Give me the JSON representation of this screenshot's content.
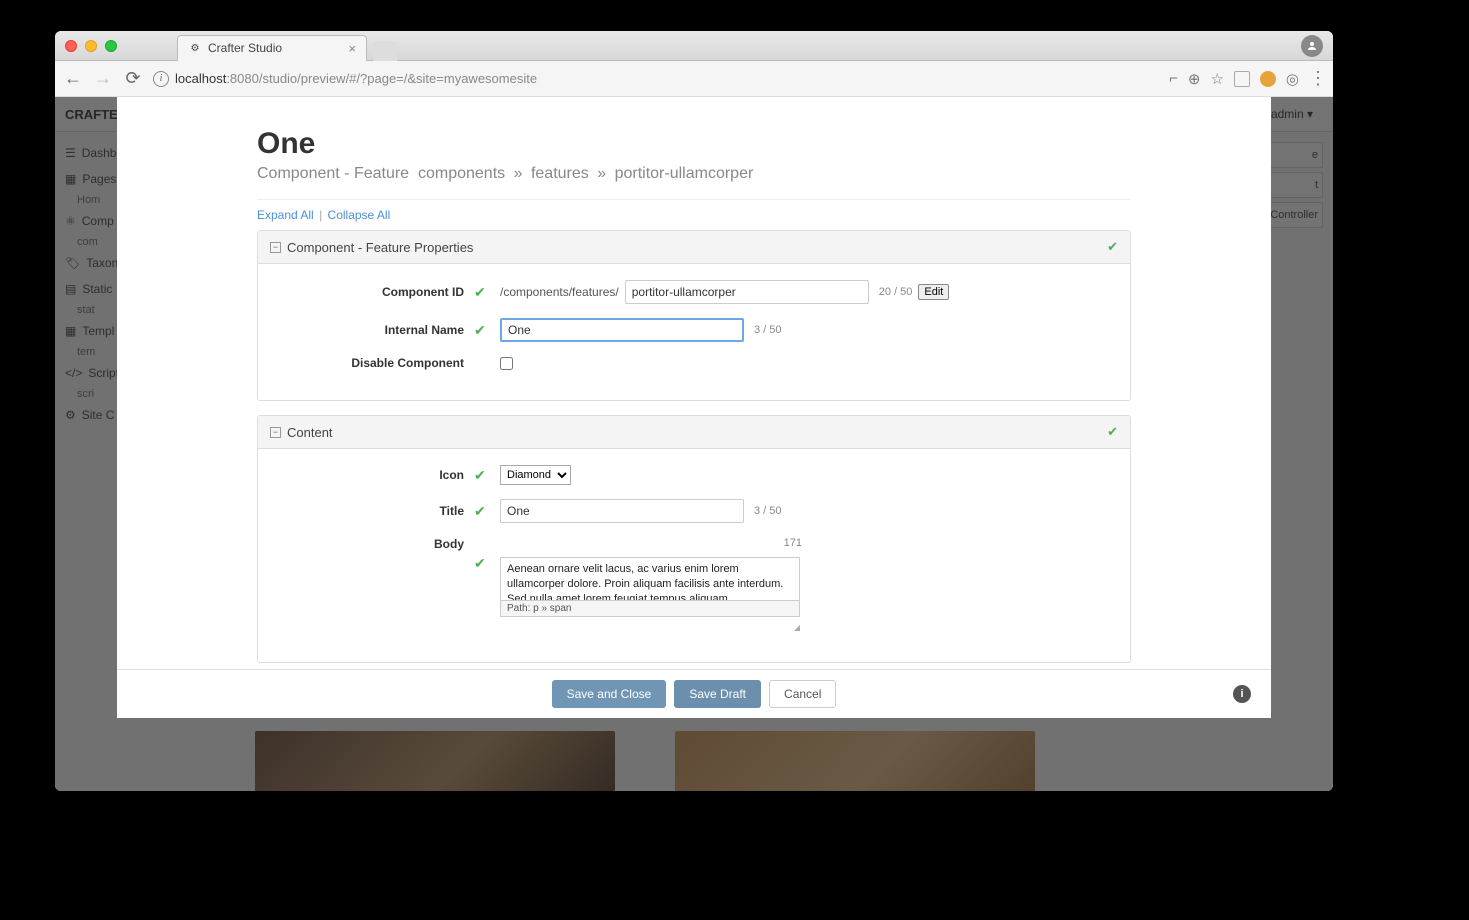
{
  "browser": {
    "tab_title": "Crafter Studio",
    "url_host": "localhost",
    "url_port": ":8080",
    "url_path": "/studio/preview/#/?page=/&site=myawesomesite"
  },
  "app_bg": {
    "logo": "CRAFTER",
    "admin_label": "admin ▾",
    "sidebar": {
      "dashboard": "Dashb",
      "pages": "Pages",
      "pages_sub": "Hom",
      "components": "Comp",
      "components_sub": "com",
      "taxonomy": "Taxon",
      "static": "Static",
      "static_sub": "stat",
      "templates": "Templ",
      "templates_sub": "tem",
      "scripts": "Script",
      "scripts_sub": "scri",
      "siteconfig": "Site C"
    },
    "right_panel": {
      "item1": "e",
      "item2": "t",
      "controller": "Controller"
    }
  },
  "form": {
    "title": "One",
    "breadcrumb": {
      "type": "Component - Feature",
      "p1": "components",
      "p2": "features",
      "p3": "portitor-ullamcorper"
    },
    "expand_all": "Expand All",
    "collapse_all": "Collapse All",
    "sections": {
      "properties": {
        "title": "Component - Feature Properties",
        "fields": {
          "component_id": {
            "label": "Component ID",
            "prefix": "/components/features/",
            "value": "portitor-ullamcorper",
            "counter": "20 / 50",
            "edit": "Edit"
          },
          "internal_name": {
            "label": "Internal Name",
            "value": "One",
            "counter": "3 / 50"
          },
          "disable": {
            "label": "Disable Component"
          }
        }
      },
      "content": {
        "title": "Content",
        "fields": {
          "icon": {
            "label": "Icon",
            "value": "Diamond"
          },
          "title": {
            "label": "Title",
            "value": "One",
            "counter": "3 / 50"
          },
          "body": {
            "label": "Body",
            "count": "171",
            "text": "Aenean ornare velit lacus, ac varius enim lorem ullamcorper dolore. Proin aliquam facilisis ante interdum. Sed nulla amet lorem feugiat tempus aliquam.",
            "path": "Path: p » span"
          }
        }
      }
    },
    "footer": {
      "save_close": "Save and Close",
      "save_draft": "Save Draft",
      "cancel": "Cancel"
    }
  }
}
